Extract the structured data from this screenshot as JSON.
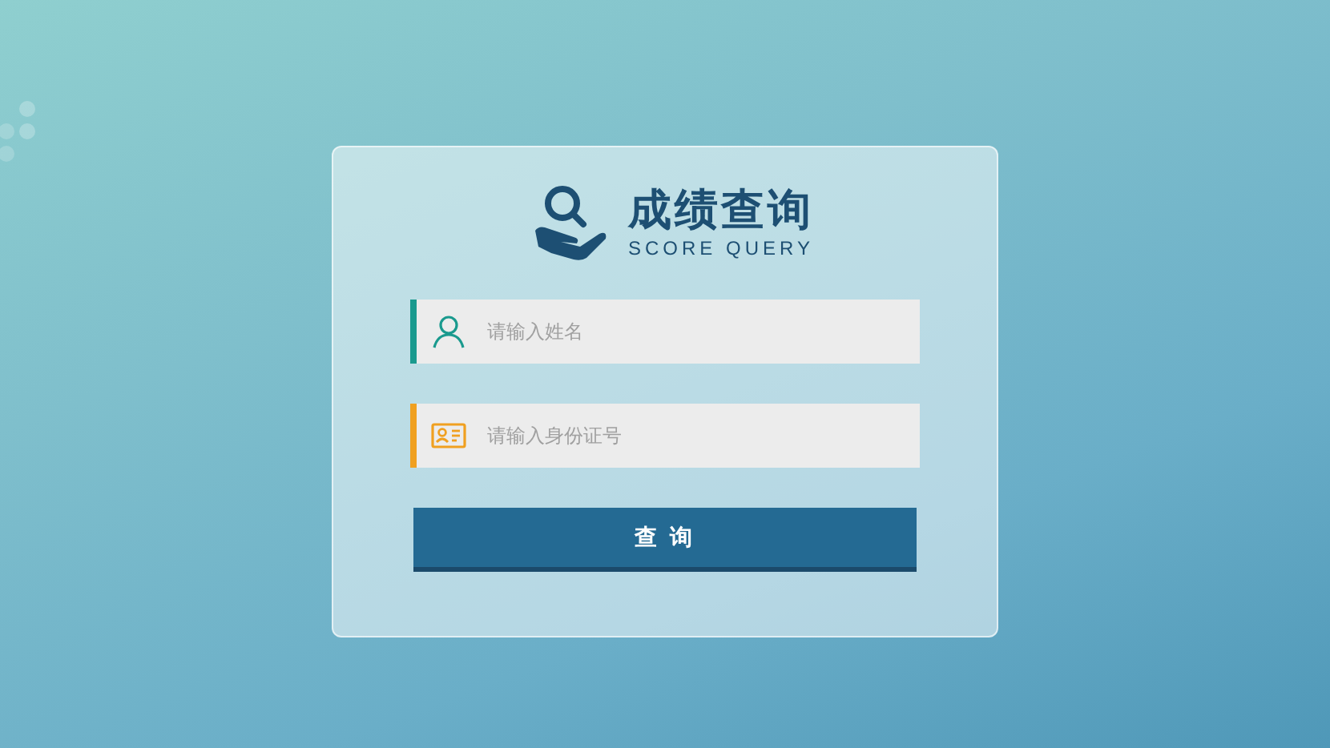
{
  "logo": {
    "title": "成绩查询",
    "subtitle": "SCORE QUERY"
  },
  "fields": [
    {
      "kind": "person",
      "placeholder": "请输入姓名",
      "color": "#1a9a8e"
    },
    {
      "kind": "id-card",
      "placeholder": "请输入身份证号",
      "color": "#f0a020"
    }
  ],
  "submit_button": {
    "label": "查 询"
  }
}
